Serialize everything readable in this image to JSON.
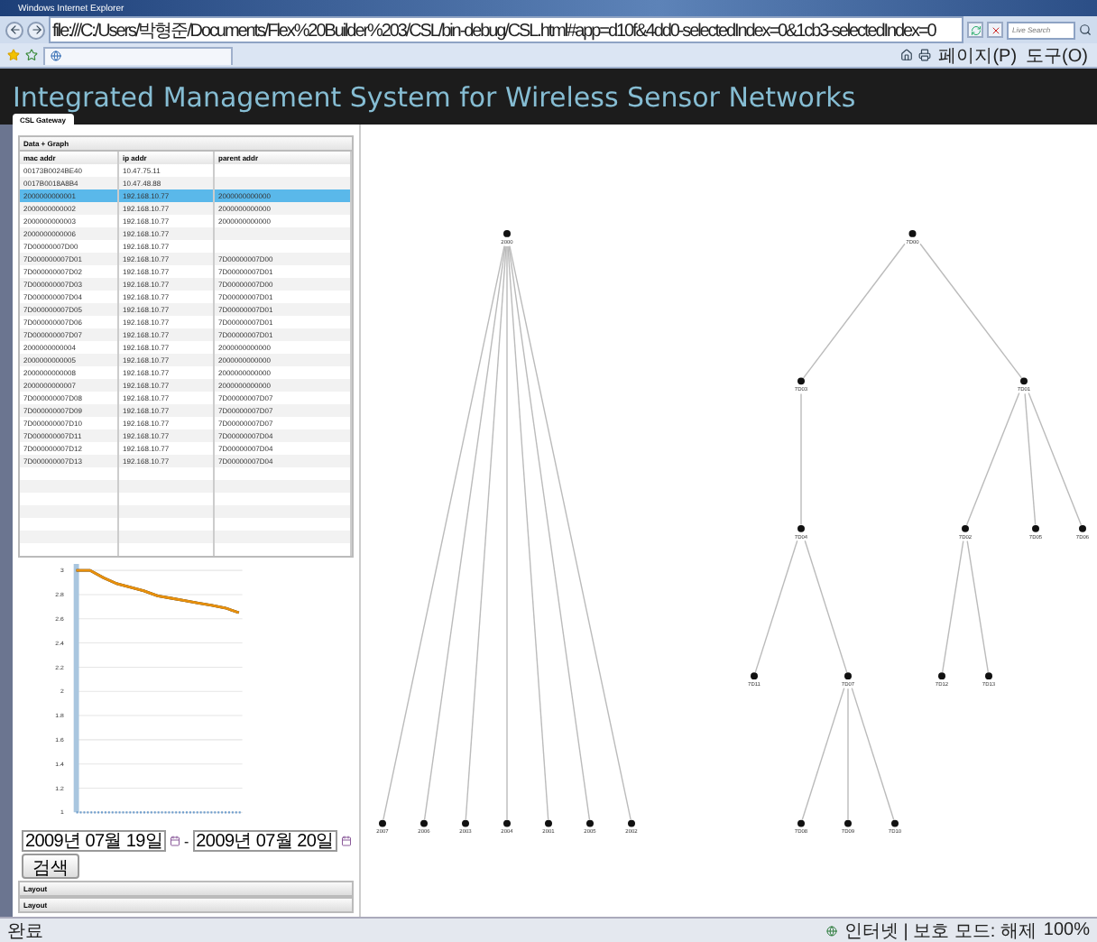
{
  "browser": {
    "title": "Windows Internet Explorer",
    "address": "file:///C:/Users/박형준/Documents/Flex%20Builder%203/CSL/bin-debug/CSL.html#app=d10f&4dd0-selectedIndex=0&1cb3-selectedIndex=0",
    "search_placeholder": "Live Search",
    "toolbar": [
      "페이지(P)",
      "도구(O)"
    ]
  },
  "app": {
    "title": "Integrated Management System for Wireless Sensor Networks",
    "tabs": [
      {
        "label": "CSL Gateway",
        "selected": true
      }
    ]
  },
  "panel": {
    "title": "Data + Graph",
    "table": {
      "columns": [
        "mac addr",
        "ip addr",
        "parent addr"
      ],
      "rows": [
        {
          "mac": "00173B0024BE40",
          "ip": "10.47.75.11",
          "selected": false
        },
        {
          "mac": "0017B0018A8B4",
          "ip": "10.47.48.88",
          "selected": false
        },
        {
          "mac": "2000000000001",
          "ip": "192.168.10.77",
          "parent": "2000000000000",
          "selected": true
        },
        {
          "mac": "2000000000002",
          "ip": "192.168.10.77",
          "parent": "2000000000000",
          "selected": false
        },
        {
          "mac": "2000000000003",
          "ip": "192.168.10.77",
          "parent": "2000000000000",
          "selected": false
        },
        {
          "mac": "2000000000006",
          "ip": "192.168.10.77",
          "selected": false
        },
        {
          "mac": "7D00000007D00",
          "ip": "192.168.10.77",
          "selected": false
        },
        {
          "mac": "7D000000007D01",
          "ip": "192.168.10.77",
          "parent": "7D00000007D00",
          "selected": false
        },
        {
          "mac": "7D000000007D02",
          "ip": "192.168.10.77",
          "parent": "7D00000007D01",
          "selected": false
        },
        {
          "mac": "7D000000007D03",
          "ip": "192.168.10.77",
          "parent": "7D00000007D00",
          "selected": false
        },
        {
          "mac": "7D000000007D04",
          "ip": "192.168.10.77",
          "parent": "7D00000007D01",
          "selected": false
        },
        {
          "mac": "7D000000007D05",
          "ip": "192.168.10.77",
          "parent": "7D00000007D01",
          "selected": false
        },
        {
          "mac": "7D000000007D06",
          "ip": "192.168.10.77",
          "parent": "7D00000007D01",
          "selected": false
        },
        {
          "mac": "7D000000007D07",
          "ip": "192.168.10.77",
          "parent": "7D00000007D01",
          "selected": false
        },
        {
          "mac": "2000000000004",
          "ip": "192.168.10.77",
          "parent": "2000000000000",
          "selected": false
        },
        {
          "mac": "2000000000005",
          "ip": "192.168.10.77",
          "parent": "2000000000000",
          "selected": false
        },
        {
          "mac": "2000000000008",
          "ip": "192.168.10.77",
          "parent": "2000000000000",
          "selected": false
        },
        {
          "mac": "2000000000007",
          "ip": "192.168.10.77",
          "parent": "2000000000000",
          "selected": false
        },
        {
          "mac": "7D000000007D08",
          "ip": "192.168.10.77",
          "parent": "7D00000007D07",
          "selected": false
        },
        {
          "mac": "7D000000007D09",
          "ip": "192.168.10.77",
          "parent": "7D00000007D07",
          "selected": false
        },
        {
          "mac": "7D000000007D10",
          "ip": "192.168.10.77",
          "parent": "7D00000007D07",
          "selected": false
        },
        {
          "mac": "7D000000007D11",
          "ip": "192.168.10.77",
          "parent": "7D00000007D04",
          "selected": false
        },
        {
          "mac": "7D000000007D12",
          "ip": "192.168.10.77",
          "parent": "7D00000007D04",
          "selected": false
        },
        {
          "mac": "7D000000007D13",
          "ip": "192.168.10.77",
          "parent": "7D00000007D04",
          "selected": false
        }
      ]
    },
    "chart_data": {
      "type": "line",
      "grid": true,
      "ylim": [
        1,
        3
      ],
      "yticks": [
        1,
        1.2,
        1.4,
        1.6,
        1.8,
        2,
        2.2,
        2.4,
        2.6,
        2.8,
        3
      ],
      "series": [
        {
          "color": "#e8900c",
          "values": [
            3,
            3,
            2.94,
            2.89,
            2.86,
            2.83,
            2.79,
            2.77,
            2.75,
            2.73,
            2.71,
            2.69,
            2.65
          ]
        }
      ]
    },
    "date_from": "2009년 07월 19일",
    "date_separator": "-",
    "date_to": "2009년 07월 20일",
    "search_button": "검색",
    "sections": [
      "Layout",
      "Layout"
    ]
  },
  "topology": {
    "trees": [
      {
        "label": "2000",
        "children": [
          {
            "label": "2007"
          },
          {
            "label": "2006"
          },
          {
            "label": "2003"
          },
          {
            "label": "2004"
          },
          {
            "label": "2001"
          },
          {
            "label": "2005"
          },
          {
            "label": "2002"
          }
        ]
      },
      {
        "label": "7D00",
        "children": [
          {
            "label": "7D03",
            "children": [
              {
                "label": "7D04",
                "children": [
                  {
                    "label": "7D11"
                  },
                  {
                    "label": "7D07",
                    "children": [
                      {
                        "label": "7D08"
                      },
                      {
                        "label": "7D09"
                      },
                      {
                        "label": "7D10"
                      }
                    ]
                  }
                ]
              }
            ]
          },
          {
            "label": "7D01",
            "children": [
              {
                "label": "7D02",
                "children": [
                  {
                    "label": "7D12"
                  },
                  {
                    "label": "7D13"
                  }
                ]
              },
              {
                "label": "7D05"
              },
              {
                "label": "7D06"
              }
            ]
          }
        ]
      }
    ]
  },
  "status": {
    "text": "완료",
    "zone": "인터넷 | 보호 모드: 해제",
    "zoom": "100%"
  }
}
